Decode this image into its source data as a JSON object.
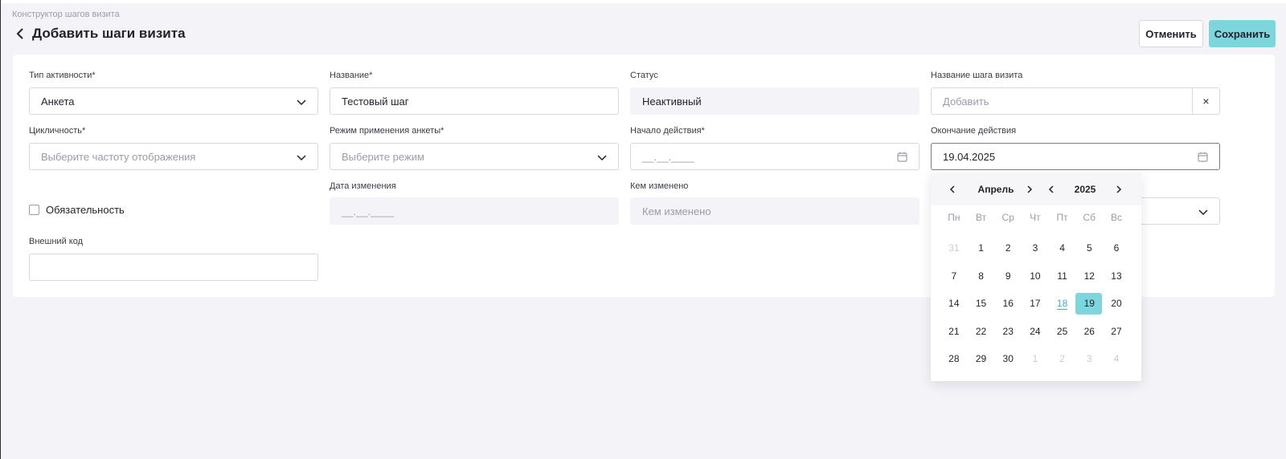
{
  "breadcrumb": "Конструктор шагов визита",
  "title": "Добавить шаги визита",
  "buttons": {
    "cancel": "Отменить",
    "save": "Сохранить"
  },
  "fields": {
    "activity_type": {
      "label": "Тип активности*",
      "value": "Анкета"
    },
    "name": {
      "label": "Название*",
      "value": "Тестовый шаг"
    },
    "status": {
      "label": "Статус",
      "value": "Неактивный"
    },
    "step_name": {
      "label": "Название шага визита",
      "placeholder": "Добавить",
      "clear": "×"
    },
    "cyclicity": {
      "label": "Цикличность*",
      "placeholder": "Выберите частоту отображения"
    },
    "mode": {
      "label": "Режим применения анкеты*",
      "placeholder": "Выберите режим"
    },
    "start": {
      "label": "Начало действия*",
      "value": "__.__.____"
    },
    "end": {
      "label": "Окончание действия",
      "value": "19.04.2025"
    },
    "changed_date": {
      "label": "Дата изменения",
      "value": "__.__.____"
    },
    "changed_by": {
      "label": "Кем изменено",
      "placeholder": "Кем изменено"
    },
    "mandatory": {
      "label": "Обязательность"
    },
    "external_code": {
      "label": "Внешний код",
      "value": ""
    }
  },
  "calendar": {
    "month": "Апрель",
    "year": "2025",
    "weekdays": [
      "Пн",
      "Вт",
      "Ср",
      "Чт",
      "Пт",
      "Сб",
      "Вс"
    ],
    "days": [
      {
        "d": "31",
        "out": true
      },
      {
        "d": "1"
      },
      {
        "d": "2"
      },
      {
        "d": "3"
      },
      {
        "d": "4"
      },
      {
        "d": "5"
      },
      {
        "d": "6"
      },
      {
        "d": "7"
      },
      {
        "d": "8"
      },
      {
        "d": "9"
      },
      {
        "d": "10"
      },
      {
        "d": "11"
      },
      {
        "d": "12"
      },
      {
        "d": "13"
      },
      {
        "d": "14"
      },
      {
        "d": "15"
      },
      {
        "d": "16"
      },
      {
        "d": "17"
      },
      {
        "d": "18",
        "today": true
      },
      {
        "d": "19",
        "selected": true
      },
      {
        "d": "20"
      },
      {
        "d": "21"
      },
      {
        "d": "22"
      },
      {
        "d": "23"
      },
      {
        "d": "24"
      },
      {
        "d": "25"
      },
      {
        "d": "26"
      },
      {
        "d": "27"
      },
      {
        "d": "28"
      },
      {
        "d": "29"
      },
      {
        "d": "30"
      },
      {
        "d": "1",
        "out": true
      },
      {
        "d": "2",
        "out": true
      },
      {
        "d": "3",
        "out": true
      },
      {
        "d": "4",
        "out": true
      }
    ]
  },
  "colors": {
    "accent": "#7dd6dc",
    "today": "#3eb3bd",
    "background": "#f3f3f8"
  },
  "icons": {
    "back": "chevron-left-icon",
    "dropdown": "chevron-down-icon",
    "date": "calendar-icon"
  }
}
